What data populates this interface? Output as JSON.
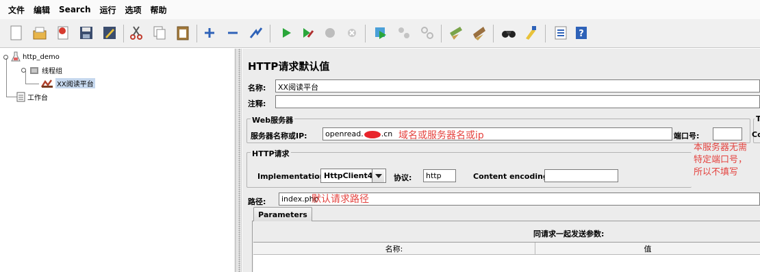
{
  "menu": [
    "文件",
    "编辑",
    "Search",
    "运行",
    "选项",
    "帮助"
  ],
  "toolbar": {
    "icons": [
      "new-icon",
      "templates-icon",
      "open-icon",
      "save-icon",
      "save-as-icon",
      "cut-icon",
      "copy-icon",
      "paste-icon",
      "expand-icon",
      "collapse-icon",
      "toggle-icon",
      "start-icon",
      "start-no-pauses-icon",
      "stop-icon",
      "shutdown-icon",
      "remote-start-icon",
      "remote-stop-icon",
      "remote-shutdown-icon",
      "clear-icon",
      "clear-all-icon",
      "search-icon",
      "reset-search-icon",
      "function-helper-icon",
      "help-icon"
    ]
  },
  "tree": {
    "root": "http_demo",
    "thread_group": "线程组",
    "selected": "XX阅读平台",
    "workbench": "工作台"
  },
  "panel": {
    "title": "HTTP请求默认值",
    "name_label": "名称:",
    "name_value": "XX阅读平台",
    "comment_label": "注释:",
    "comment_value": "",
    "web_server": {
      "group_title": "Web服务器",
      "server_label": "服务器名称或IP:",
      "server_value_prefix": "openread.",
      "server_value_suffix": ".cn",
      "port_label": "端口号:",
      "port_value": "",
      "timeout_group_label": "Ti",
      "connect_label": "Co"
    },
    "http_request": {
      "group_title": "HTTP请求",
      "implementation_label": "Implementation:",
      "implementation_value": "HttpClient4",
      "protocol_label": "协议:",
      "protocol_value": "http",
      "encoding_label": "Content encoding:",
      "encoding_value": ""
    },
    "path_label": "路径:",
    "path_value": "index.php",
    "tab": "Parameters",
    "params_caption": "同请求一起发送参数:",
    "columns": [
      "名称:",
      "值"
    ]
  },
  "annotations": {
    "server_note": "域名或服务器名或ip",
    "port_note": [
      "本服务器无需",
      "特定端口号，",
      "所以不填写"
    ],
    "path_note": "默认请求路径"
  },
  "colors": {
    "annotation": "#e4433f",
    "selection": "#c6d8ee",
    "panel_bg": "#ececec"
  }
}
